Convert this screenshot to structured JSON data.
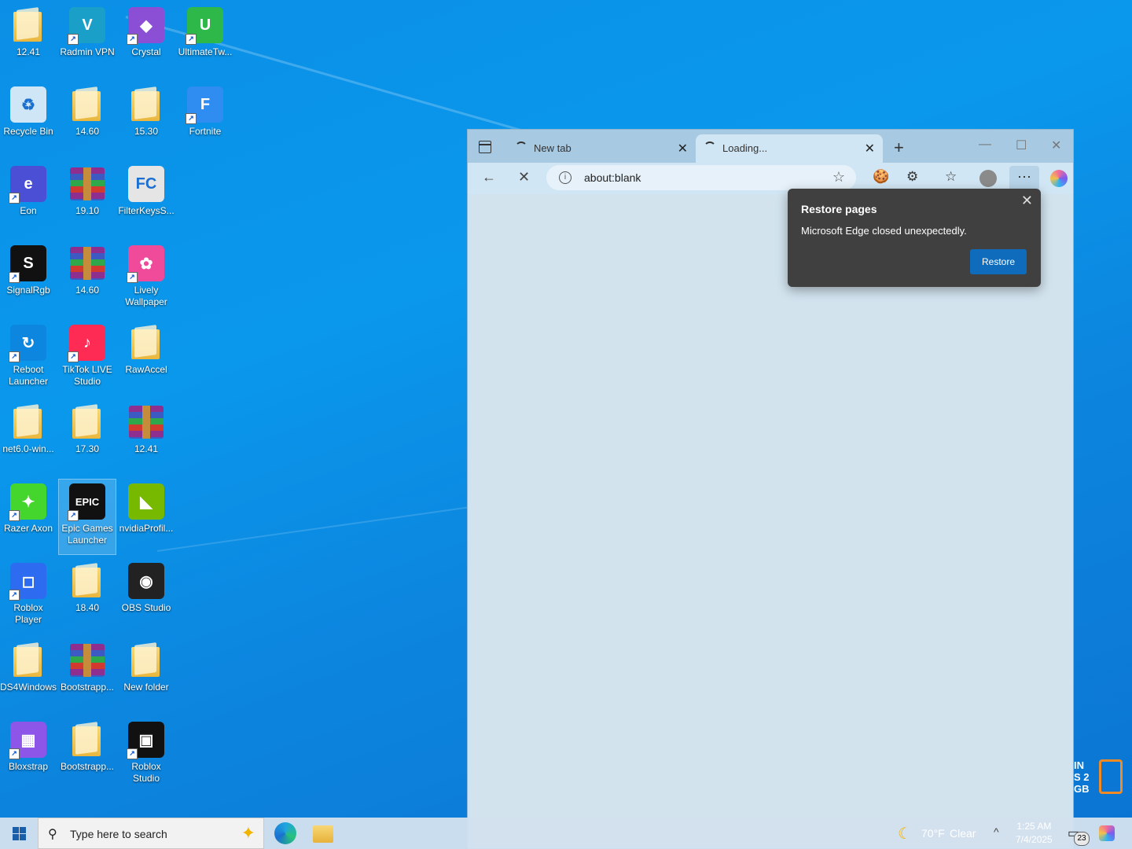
{
  "desktop": {
    "icons": [
      {
        "label": "12.41",
        "kind": "folder"
      },
      {
        "label": "Radmin VPN",
        "kind": "radmin"
      },
      {
        "label": "Crystal",
        "kind": "crystal"
      },
      {
        "label": "UltimateTw...",
        "kind": "ultimate"
      },
      {
        "label": "Recycle Bin",
        "kind": "recycle"
      },
      {
        "label": "14.60",
        "kind": "folder"
      },
      {
        "label": "15.30",
        "kind": "folder"
      },
      {
        "label": "Fortnite",
        "kind": "fortnite"
      },
      {
        "label": "Eon",
        "kind": "eon"
      },
      {
        "label": "19.10",
        "kind": "rar"
      },
      {
        "label": "FilterKeysS...",
        "kind": "filterkeys"
      },
      {
        "label": "SignalRgb",
        "kind": "signalrgb"
      },
      {
        "label": "14.60",
        "kind": "rar"
      },
      {
        "label": "Lively Wallpaper",
        "kind": "lively"
      },
      {
        "label": "Reboot Launcher",
        "kind": "reboot"
      },
      {
        "label": "TikTok LIVE Studio",
        "kind": "tiktok"
      },
      {
        "label": "RawAccel",
        "kind": "folder"
      },
      {
        "label": "net6.0-win...",
        "kind": "folder"
      },
      {
        "label": "17.30",
        "kind": "folder"
      },
      {
        "label": "12.41",
        "kind": "rar"
      },
      {
        "label": "Razer Axon",
        "kind": "razer"
      },
      {
        "label": "Epic Games Launcher",
        "kind": "epic"
      },
      {
        "label": "nvidiaProfil...",
        "kind": "nvidia"
      },
      {
        "label": "Roblox Player",
        "kind": "roblox"
      },
      {
        "label": "18.40",
        "kind": "folder"
      },
      {
        "label": "OBS Studio",
        "kind": "obs"
      },
      {
        "label": "DS4Windows",
        "kind": "folder"
      },
      {
        "label": "Bootstrapp...",
        "kind": "rar"
      },
      {
        "label": "New folder",
        "kind": "folder"
      },
      {
        "label": "Bloxstrap",
        "kind": "bloxstrap"
      },
      {
        "label": "Bootstrapp...",
        "kind": "folder"
      },
      {
        "label": "Roblox Studio",
        "kind": "robloxstudio"
      }
    ]
  },
  "browser": {
    "tabs": [
      {
        "title": "New tab",
        "active": false
      },
      {
        "title": "Loading...",
        "active": true
      }
    ],
    "address": "about:blank",
    "popup": {
      "title": "Restore pages",
      "message": "Microsoft Edge closed unexpectedly.",
      "button": "Restore"
    }
  },
  "widget_text": [
    "IN",
    "S 2",
    "GB"
  ],
  "taskbar": {
    "search_placeholder": "Type here to search",
    "weather_temp": "70°F",
    "weather_cond": "Clear",
    "time": "1:25 AM",
    "date": "7/4/2025",
    "notif_count": "23"
  }
}
